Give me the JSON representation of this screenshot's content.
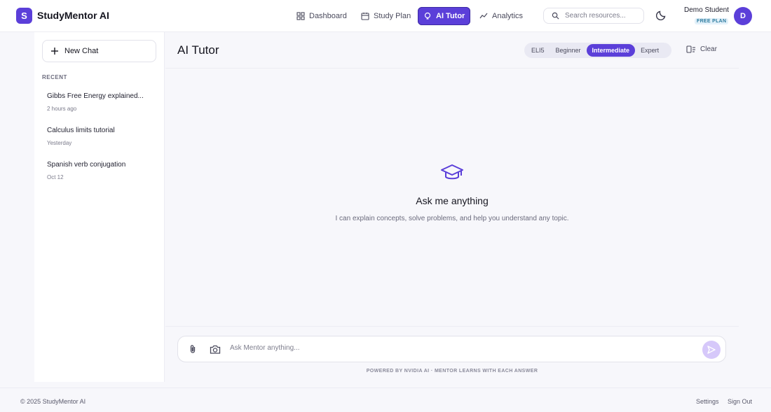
{
  "header": {
    "logo_letter": "S",
    "brand": "StudyMentor AI",
    "nav": [
      {
        "label": "Dashboard",
        "icon": "grid-icon"
      },
      {
        "label": "Study Plan",
        "icon": "calendar-icon"
      },
      {
        "label": "AI Tutor",
        "icon": "lightbulb-icon",
        "active": true
      },
      {
        "label": "Analytics",
        "icon": "trend-icon"
      }
    ],
    "search_placeholder": "Search resources...",
    "user_name": "Demo Student",
    "plan": "FREE PLAN",
    "avatar_letter": "D"
  },
  "sidebar": {
    "new_chat_label": "New Chat",
    "recent_label": "RECENT",
    "chats": [
      {
        "title": "Gibbs Free Energy explained...",
        "time": "2 hours ago"
      },
      {
        "title": "Calculus limits tutorial",
        "time": "Yesterday"
      },
      {
        "title": "Spanish verb conjugation",
        "time": "Oct 12"
      }
    ]
  },
  "main": {
    "title": "AI Tutor",
    "levels": [
      "ELI5",
      "Beginner",
      "Intermediate",
      "Expert"
    ],
    "active_level": "Intermediate",
    "clear_label": "Clear",
    "empty_title": "Ask me anything",
    "empty_subtitle": "I can explain concepts, solve problems, and help you understand any topic.",
    "composer_placeholder": "Ask Mentor anything...",
    "powered_by": "POWERED BY NVIDIA AI · MENTOR LEARNS WITH EACH ANSWER"
  },
  "footer": {
    "copyright": "© 2025 StudyMentor AI",
    "settings": "Settings",
    "sign_out": "Sign Out"
  },
  "colors": {
    "accent": "#5b3fd9",
    "send_button": "#d6c8fa",
    "background": "#f7f7fb"
  }
}
